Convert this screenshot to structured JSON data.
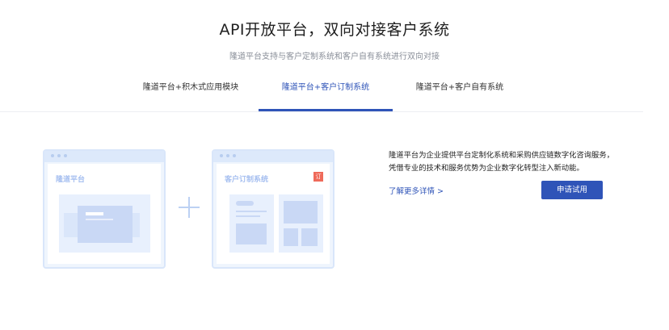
{
  "header": {
    "title": "API开放平台，双向对接客户系统",
    "subtitle": "隆道平台支持与客户定制系统和客户自有系统进行双向对接"
  },
  "tabs": [
    {
      "label": "隆道平台+积木式应用模块",
      "active": false
    },
    {
      "label": "隆道平台+客户订制系统",
      "active": true
    },
    {
      "label": "隆道平台+客户自有系统",
      "active": false
    }
  ],
  "illustration": {
    "card1_label": "隆道平台",
    "card2_label": "客户订制系统",
    "card2_badge": "订",
    "plus_icon": "plus-icon"
  },
  "content": {
    "description": "隆道平台为企业提供平台定制化系统和采购供应链数字化咨询服务，凭借专业的技术和服务优势为企业数字化转型注入新动能。",
    "more_link": "了解更多详情 >",
    "apply_button": "申请试用"
  },
  "colors": {
    "accent": "#2f54b8",
    "badge": "#ef6a5a",
    "illustration_light": "#eff5fd"
  }
}
